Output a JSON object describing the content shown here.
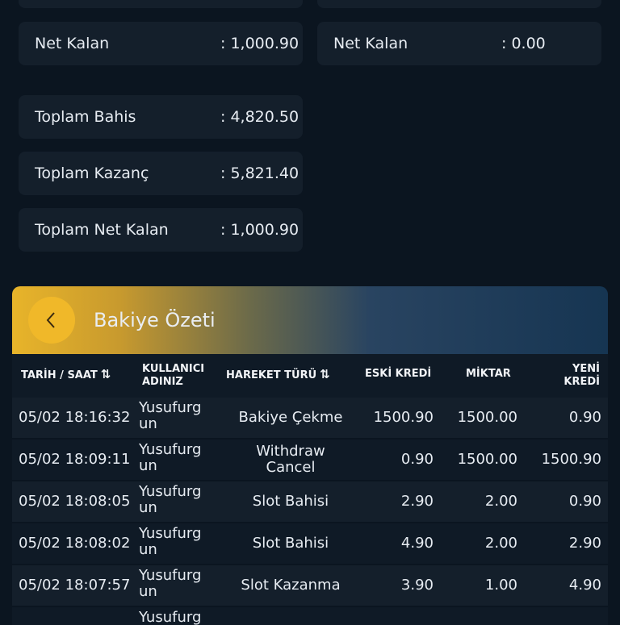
{
  "summary": {
    "left": [
      {
        "label": "Net Kalan",
        "value": ": 1,000.90"
      },
      {
        "label": "Toplam Bahis",
        "value": ": 4,820.50"
      },
      {
        "label": "Toplam Kazanç",
        "value": ": 5,821.40"
      },
      {
        "label": "Toplam Net Kalan",
        "value": ": 1,000.90"
      }
    ],
    "right": [
      {
        "label": "Net Kalan",
        "value": ": 0.00"
      }
    ]
  },
  "panel": {
    "title": "Bakiye Özeti",
    "back_icon": "chevron-left-icon"
  },
  "table": {
    "headers": {
      "date": "TARİH / SAAT",
      "user_line1": "KULLANICI",
      "user_line2": "ADINIZ",
      "type": "HAREKET TÜRÜ",
      "old": "ESKİ KREDİ",
      "amount": "MİKTAR",
      "new_line1": "YENİ",
      "new_line2": "KREDİ",
      "sort_icon": "⇅"
    },
    "rows": [
      {
        "date": "05/02 18:16:32",
        "user1": "Yusufurg",
        "user2": "un",
        "type": "Bakiye Çekme",
        "old": "1500.90",
        "amount": "1500.00",
        "new": "0.90"
      },
      {
        "date": "05/02 18:09:11",
        "user1": "Yusufurg",
        "user2": "un",
        "type": "Withdraw Cancel",
        "old": "0.90",
        "amount": "1500.00",
        "new": "1500.90"
      },
      {
        "date": "05/02 18:08:05",
        "user1": "Yusufurg",
        "user2": "un",
        "type": "Slot Bahisi",
        "old": "2.90",
        "amount": "2.00",
        "new": "0.90"
      },
      {
        "date": "05/02 18:08:02",
        "user1": "Yusufurg",
        "user2": "un",
        "type": "Slot Bahisi",
        "old": "4.90",
        "amount": "2.00",
        "new": "2.90"
      },
      {
        "date": "05/02 18:07:57",
        "user1": "Yusufurg",
        "user2": "un",
        "type": "Slot Kazanma",
        "old": "3.90",
        "amount": "1.00",
        "new": "4.90"
      },
      {
        "date": "",
        "user1": "Yusufurg",
        "user2": "",
        "type": "",
        "old": "",
        "amount": "",
        "new": ""
      }
    ]
  }
}
